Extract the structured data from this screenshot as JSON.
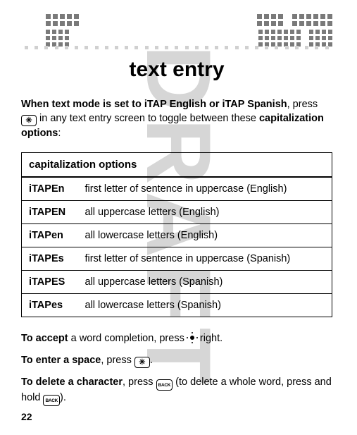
{
  "watermark": "DRAFT",
  "title": "text entry",
  "intro": {
    "p1a": "When text mode is set to",
    "mode1": "iTAP English",
    "or": " or ",
    "mode2": "iTAP Spanish",
    "p1b": ", press ",
    "p1c": " in any text entry screen to toggle between these ",
    "p1d": "capitalization options",
    "p1e": ":"
  },
  "table": {
    "header": "capitalization options",
    "rows": [
      {
        "code": "iTAPEn",
        "desc": "first letter of sentence in uppercase (English)"
      },
      {
        "code": "iTAPEN",
        "desc": "all uppercase letters (English)"
      },
      {
        "code": "iTAPen",
        "desc": "all lowercase letters (English)"
      },
      {
        "code": "iTAPEs",
        "desc": "first letter of sentence in uppercase (Spanish)"
      },
      {
        "code": "iTAPES",
        "desc": "all uppercase letters (Spanish)"
      },
      {
        "code": "iTAPes",
        "desc": "all lowercase letters (Spanish)"
      }
    ]
  },
  "para1": {
    "a": "To accept",
    "b": " a word completion, press ",
    "c": " right."
  },
  "para2": {
    "a": "To enter a space",
    "b": ", press ",
    "c": "."
  },
  "para3": {
    "a": "To delete a character",
    "b": ", press ",
    "c": " (to delete a whole word, press and hold ",
    "d": ")."
  },
  "page": "22"
}
